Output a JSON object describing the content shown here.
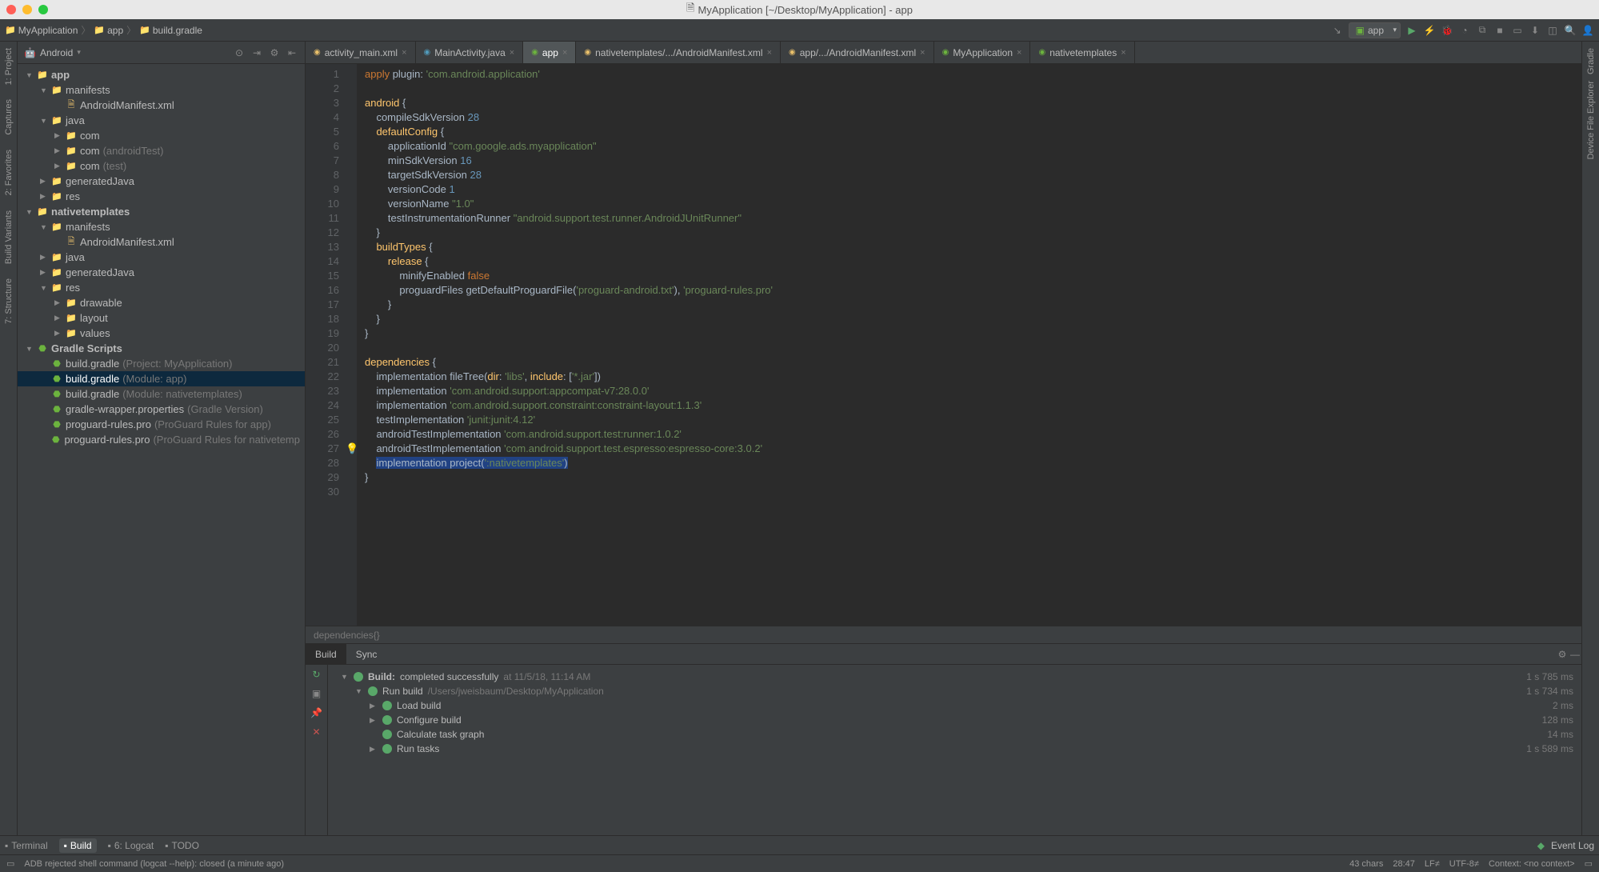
{
  "window": {
    "title": "MyApplication [~/Desktop/MyApplication] - app"
  },
  "breadcrumbs": [
    {
      "label": "MyApplication"
    },
    {
      "label": "app"
    },
    {
      "label": "build.gradle"
    }
  ],
  "run_config": {
    "label": "app"
  },
  "left_gutter": [
    {
      "label": "1: Project"
    },
    {
      "label": "Captures"
    },
    {
      "label": "2: Favorites"
    },
    {
      "label": "Build Variants"
    },
    {
      "label": "7: Structure"
    }
  ],
  "right_gutter": [
    {
      "label": "Gradle"
    },
    {
      "label": "Device File Explorer"
    }
  ],
  "project_panel": {
    "title": "Android",
    "tree": [
      {
        "d": 0,
        "a": "▼",
        "ic": "i-module",
        "g": "📁",
        "l": "app",
        "bold": true
      },
      {
        "d": 1,
        "a": "▼",
        "ic": "i-folder",
        "g": "📁",
        "l": "manifests"
      },
      {
        "d": 2,
        "a": "",
        "ic": "i-xml",
        "g": "🗎",
        "l": "AndroidManifest.xml"
      },
      {
        "d": 1,
        "a": "▼",
        "ic": "i-folder",
        "g": "📁",
        "l": "java"
      },
      {
        "d": 2,
        "a": "▶",
        "ic": "i-folder",
        "g": "📁",
        "l": "com"
      },
      {
        "d": 2,
        "a": "▶",
        "ic": "i-folder",
        "g": "📁",
        "l": "com",
        "hint": " (androidTest)"
      },
      {
        "d": 2,
        "a": "▶",
        "ic": "i-folder",
        "g": "📁",
        "l": "com",
        "hint": " (test)"
      },
      {
        "d": 1,
        "a": "▶",
        "ic": "i-folder",
        "g": "📁",
        "l": "generatedJava"
      },
      {
        "d": 1,
        "a": "▶",
        "ic": "i-folder",
        "g": "📁",
        "l": "res"
      },
      {
        "d": 0,
        "a": "▼",
        "ic": "i-module",
        "g": "📁",
        "l": "nativetemplates",
        "bold": true
      },
      {
        "d": 1,
        "a": "▼",
        "ic": "i-folder",
        "g": "📁",
        "l": "manifests"
      },
      {
        "d": 2,
        "a": "",
        "ic": "i-xml",
        "g": "🗎",
        "l": "AndroidManifest.xml"
      },
      {
        "d": 1,
        "a": "▶",
        "ic": "i-folder",
        "g": "📁",
        "l": "java"
      },
      {
        "d": 1,
        "a": "▶",
        "ic": "i-folder",
        "g": "📁",
        "l": "generatedJava"
      },
      {
        "d": 1,
        "a": "▼",
        "ic": "i-folder",
        "g": "📁",
        "l": "res"
      },
      {
        "d": 2,
        "a": "▶",
        "ic": "i-folder",
        "g": "📁",
        "l": "drawable"
      },
      {
        "d": 2,
        "a": "▶",
        "ic": "i-folder",
        "g": "📁",
        "l": "layout"
      },
      {
        "d": 2,
        "a": "▶",
        "ic": "i-folder",
        "g": "📁",
        "l": "values"
      },
      {
        "d": 0,
        "a": "▼",
        "ic": "i-gradle",
        "g": "⬣",
        "l": "Gradle Scripts",
        "bold": true
      },
      {
        "d": 1,
        "a": "",
        "ic": "i-gradle",
        "g": "⬣",
        "l": "build.gradle",
        "hint": " (Project: MyApplication)"
      },
      {
        "d": 1,
        "a": "",
        "ic": "i-gradle",
        "g": "⬣",
        "l": "build.gradle",
        "hint": " (Module: app)",
        "selected": true
      },
      {
        "d": 1,
        "a": "",
        "ic": "i-gradle",
        "g": "⬣",
        "l": "build.gradle",
        "hint": " (Module: nativetemplates)"
      },
      {
        "d": 1,
        "a": "",
        "ic": "i-gradle",
        "g": "⬣",
        "l": "gradle-wrapper.properties",
        "hint": " (Gradle Version)"
      },
      {
        "d": 1,
        "a": "",
        "ic": "i-gradle",
        "g": "⬣",
        "l": "proguard-rules.pro",
        "hint": " (ProGuard Rules for app)"
      },
      {
        "d": 1,
        "a": "",
        "ic": "i-gradle",
        "g": "⬣",
        "l": "proguard-rules.pro",
        "hint": " (ProGuard Rules for nativetemp"
      }
    ]
  },
  "editor_tabs": [
    {
      "label": "activity_main.xml",
      "ic": "i-xml"
    },
    {
      "label": "MainActivity.java",
      "ic": "i-java"
    },
    {
      "label": "app",
      "ic": "i-gradle",
      "active": true
    },
    {
      "label": "nativetemplates/.../AndroidManifest.xml",
      "ic": "i-xml"
    },
    {
      "label": "app/.../AndroidManifest.xml",
      "ic": "i-xml"
    },
    {
      "label": "MyApplication",
      "ic": "i-gradle"
    },
    {
      "label": "nativetemplates",
      "ic": "i-gradle"
    }
  ],
  "code_lines": [
    {
      "n": 1,
      "h": "<span class='kw'>apply</span> plugin: <span class='str'>'com.android.application'</span>"
    },
    {
      "n": 2,
      "h": ""
    },
    {
      "n": 3,
      "h": "<span class='fn'>android</span> {"
    },
    {
      "n": 4,
      "h": "    compileSdkVersion <span class='num'>28</span>"
    },
    {
      "n": 5,
      "h": "    <span class='fn'>defaultConfig</span> {"
    },
    {
      "n": 6,
      "h": "        applicationId <span class='str'>\"com.google.ads.myapplication\"</span>"
    },
    {
      "n": 7,
      "h": "        minSdkVersion <span class='num'>16</span>"
    },
    {
      "n": 8,
      "h": "        targetSdkVersion <span class='num'>28</span>"
    },
    {
      "n": 9,
      "h": "        versionCode <span class='num'>1</span>"
    },
    {
      "n": 10,
      "h": "        versionName <span class='str'>\"1.0\"</span>"
    },
    {
      "n": 11,
      "h": "        testInstrumentationRunner <span class='str'>\"android.support.test.runner.AndroidJUnitRunner\"</span>"
    },
    {
      "n": 12,
      "h": "    }"
    },
    {
      "n": 13,
      "h": "    <span class='fn'>buildTypes</span> {"
    },
    {
      "n": 14,
      "h": "        <span class='fn'>release</span> {"
    },
    {
      "n": 15,
      "h": "            minifyEnabled <span class='kw'>false</span>"
    },
    {
      "n": 16,
      "h": "            proguardFiles getDefaultProguardFile(<span class='str'>'proguard-android.txt'</span>), <span class='str'>'proguard-rules.pro'</span>"
    },
    {
      "n": 17,
      "h": "        }"
    },
    {
      "n": 18,
      "h": "    }"
    },
    {
      "n": 19,
      "h": "}"
    },
    {
      "n": 20,
      "h": ""
    },
    {
      "n": 21,
      "h": "<span class='fn'>dependencies</span> {"
    },
    {
      "n": 22,
      "h": "    implementation fileTree(<span class='fn'>dir</span>: <span class='str'>'libs'</span>, <span class='fn'>include</span>: [<span class='str'>'*.jar'</span>])"
    },
    {
      "n": 23,
      "h": "    implementation <span class='str'>'com.android.support:appcompat-v7:28.0.0'</span>"
    },
    {
      "n": 24,
      "h": "    implementation <span class='str'>'com.android.support.constraint:constraint-layout:1.1.3'</span>"
    },
    {
      "n": 25,
      "h": "    testImplementation <span class='str'>'junit:junit:4.12'</span>"
    },
    {
      "n": 26,
      "h": "    androidTestImplementation <span class='str'>'com.android.support.test:runner:1.0.2'</span>"
    },
    {
      "n": 27,
      "bulb": true,
      "h": "    androidTestImplementation <span class='str'>'com.android.support.test.espresso:espresso-core:3.0.2'</span>"
    },
    {
      "n": 28,
      "h": "    <span class='code-hl'>implementation project(<span class='str'>':nativetemplates'</span>)</span>"
    },
    {
      "n": 29,
      "h": "}"
    },
    {
      "n": 30,
      "h": ""
    }
  ],
  "editor_breadcrumb": "dependencies{}",
  "build": {
    "tabs": [
      {
        "label": "Build",
        "active": true
      },
      {
        "label": "Sync"
      }
    ],
    "rows": [
      {
        "d": 0,
        "a": "▼",
        "ok": true,
        "bold": true,
        "l": "Build:",
        "extra": " completed successfully",
        "hint": "   at 11/5/18, 11:14 AM",
        "t": "1 s 785 ms"
      },
      {
        "d": 1,
        "a": "▼",
        "ok": true,
        "l": "Run build",
        "hint": "  /Users/jweisbaum/Desktop/MyApplication",
        "t": "1 s 734 ms"
      },
      {
        "d": 2,
        "a": "▶",
        "ok": true,
        "l": "Load build",
        "t": "2 ms"
      },
      {
        "d": 2,
        "a": "▶",
        "ok": true,
        "l": "Configure build",
        "t": "128 ms"
      },
      {
        "d": 2,
        "a": "",
        "ok": true,
        "l": "Calculate task graph",
        "t": "14 ms"
      },
      {
        "d": 2,
        "a": "▶",
        "ok": true,
        "l": "Run tasks",
        "t": "1 s 589 ms"
      }
    ]
  },
  "bottom_tabs": [
    {
      "label": "Terminal"
    },
    {
      "label": "Build",
      "active": true
    },
    {
      "label": "6: Logcat"
    },
    {
      "label": "TODO"
    }
  ],
  "event_log": "Event Log",
  "status": {
    "msg": "ADB rejected shell command (logcat --help): closed (a minute ago)",
    "chars": "43 chars",
    "pos": "28:47",
    "line_sep": "LF≠",
    "encoding": "UTF-8≠",
    "context": "Context: <no context>"
  }
}
